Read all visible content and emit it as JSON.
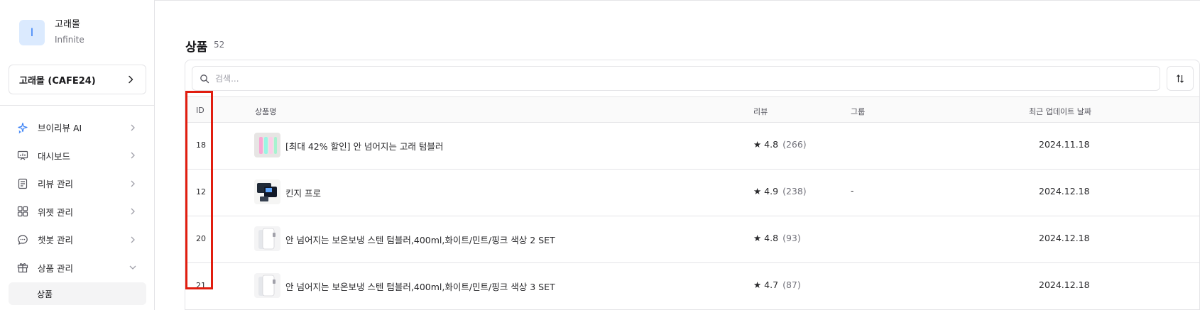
{
  "account": {
    "avatar_letter": "I",
    "name": "고래몰",
    "plan": "Infinite"
  },
  "store": {
    "label": "고래몰 (CAFE24)"
  },
  "nav": {
    "items": [
      {
        "label": "브이리뷰 AI",
        "icon": "sparkle-icon"
      },
      {
        "label": "대시보드",
        "icon": "dashboard-icon"
      },
      {
        "label": "리뷰 관리",
        "icon": "review-icon"
      },
      {
        "label": "위젯 관리",
        "icon": "widget-icon"
      },
      {
        "label": "챗봇 관리",
        "icon": "chat-icon"
      },
      {
        "label": "상품 관리",
        "icon": "gift-icon"
      }
    ],
    "sub_item": "상품"
  },
  "page": {
    "title": "상품",
    "count": "52"
  },
  "search": {
    "placeholder": "검색..."
  },
  "table": {
    "headers": {
      "id": "ID",
      "name": "상품명",
      "review": "리뷰",
      "group": "그룹",
      "updated": "최근 업데이트 날짜"
    },
    "rows": [
      {
        "id": "18",
        "name": "[최대 42% 할인] 안 넘어지는 고래 텀블러",
        "rating": "★ 4.8",
        "count": "(266)",
        "group": "",
        "date": "2024.11.18",
        "thumb": "tumbler-set"
      },
      {
        "id": "12",
        "name": "킨지 프로",
        "rating": "★ 4.9",
        "count": "(238)",
        "group": "-",
        "date": "2024.12.18",
        "thumb": "device"
      },
      {
        "id": "20",
        "name": "안 넘어지는 보온보냉 스텐 텀블러,400ml,화이트/민트/핑크 색상 2 SET",
        "rating": "★ 4.8",
        "count": "(93)",
        "group": "",
        "date": "2024.12.18",
        "thumb": "white-tumbler"
      },
      {
        "id": "21",
        "name": "안 넘어지는 보온보냉 스텐 텀블러,400ml,화이트/민트/핑크 색상 3 SET",
        "rating": "★ 4.7",
        "count": "(87)",
        "group": "",
        "date": "2024.12.18",
        "thumb": "white-tumbler"
      }
    ]
  },
  "colors": {
    "highlight": "#e11d0f",
    "avatar_bg": "#dbeafe",
    "accent": "#3b82f6"
  }
}
